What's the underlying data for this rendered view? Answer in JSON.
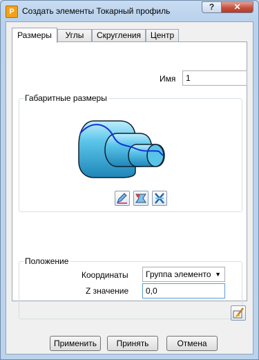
{
  "window": {
    "title": "Создать элементы Токарный профиль",
    "app_icon": "P",
    "help": "?",
    "close": "✕"
  },
  "tabs": [
    {
      "label": "Размеры",
      "active": true
    },
    {
      "label": "Углы",
      "active": false
    },
    {
      "label": "Скругления",
      "active": false
    },
    {
      "label": "Центр",
      "active": false
    }
  ],
  "name_field": {
    "label": "Имя",
    "value": "1"
  },
  "dimensions": {
    "title": "Габаритные размеры"
  },
  "position": {
    "title": "Положение",
    "coords_label": "Координаты",
    "coords_value": "Группа элементо",
    "z_label": "Z значение",
    "z_value": "0,0"
  },
  "buttons": {
    "apply": "Применить",
    "accept": "Принять",
    "cancel": "Отмена"
  },
  "colors": {
    "part_fill": "#3fb4dc",
    "profile_line": "#1030d8"
  }
}
